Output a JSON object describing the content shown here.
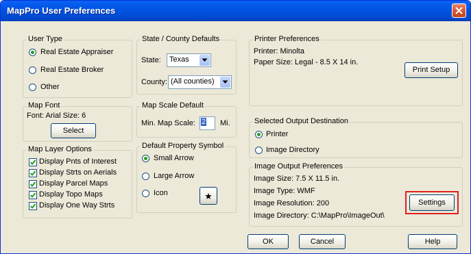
{
  "window": {
    "title": "MapPro User Preferences"
  },
  "user_type": {
    "legend": "User Type",
    "options": [
      "Real Estate Appraiser",
      "Real Estate Broker",
      "Other"
    ],
    "selected": "Real Estate Appraiser"
  },
  "map_font": {
    "legend": "Map Font",
    "font_text": "Font: Arial Size: 6",
    "select_label": "Select"
  },
  "map_layer_options": {
    "legend": "Map Layer Options",
    "items": [
      {
        "label": "Display Pnts of Interest",
        "checked": true
      },
      {
        "label": "Display Strts on Aerials",
        "checked": true
      },
      {
        "label": "Display Parcel Maps",
        "checked": true
      },
      {
        "label": "Display Topo Maps",
        "checked": true
      },
      {
        "label": "Display One Way Strts",
        "checked": true
      }
    ]
  },
  "state_county": {
    "legend": "State / County Defaults",
    "state_label": "State:",
    "state_value": "Texas",
    "county_label": "County:",
    "county_value": "(All counties)"
  },
  "map_scale": {
    "legend": "Map Scale Default",
    "label": "Min. Map Scale:",
    "value": "2",
    "unit": "Mi."
  },
  "property_symbol": {
    "legend": "Default Property Symbol",
    "options": [
      "Small Arrow",
      "Large Arrow",
      "Icon"
    ],
    "selected": "Small Arrow",
    "icon_glyph": "★"
  },
  "printer_prefs": {
    "legend": "Printer Preferences",
    "printer_text": "Printer: Minolta",
    "paper_text": "Paper Size: Legal - 8.5 X 14 in.",
    "print_setup_label": "Print Setup"
  },
  "output_destination": {
    "legend": "Selected Output Destination",
    "options": [
      "Printer",
      "Image Directory"
    ],
    "selected": "Printer"
  },
  "image_output": {
    "legend": "Image Output Preferences",
    "size_text": "Image Size: 7.5 X 11.5 in.",
    "type_text": "Image Type: WMF",
    "resolution_text": "Image Resolution: 200",
    "directory_text": "Image Directory: C:\\MapPro\\ImageOut\\",
    "settings_label": "Settings"
  },
  "footer": {
    "ok_label": "OK",
    "cancel_label": "Cancel",
    "help_label": "Help"
  },
  "colors": {
    "title_bar": "#0054e3",
    "highlight": "#e02020",
    "radio_dot": "#21a121",
    "check": "#21a121"
  }
}
